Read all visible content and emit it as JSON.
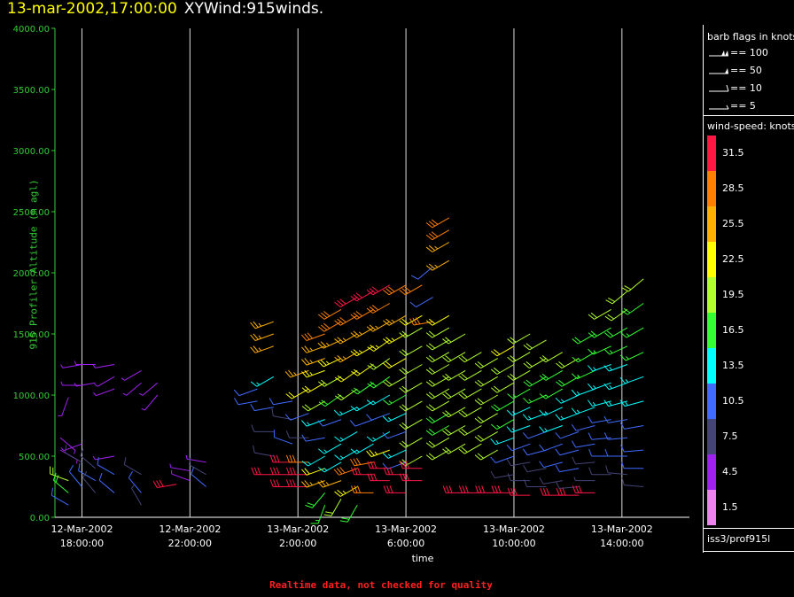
{
  "header": {
    "time": "13-mar-2002,17:00:00",
    "name": "XYWind:915winds."
  },
  "footer": "Realtime data, not checked for quality",
  "source": "iss3/prof915l",
  "legend": {
    "barb_title": "barb flags in knots",
    "barbs": [
      {
        "label": "== 100",
        "kind": "flag2"
      },
      {
        "label": "== 50",
        "kind": "flag"
      },
      {
        "label": "== 10",
        "kind": "full"
      },
      {
        "label": "== 5",
        "kind": "half"
      }
    ],
    "speed_title": "wind-speed: knots",
    "colorscale": [
      {
        "label": "31.5",
        "color": "#ff1744"
      },
      {
        "label": "28.5",
        "color": "#ff7f00"
      },
      {
        "label": "25.5",
        "color": "#ffb000"
      },
      {
        "label": "22.5",
        "color": "#ffff00"
      },
      {
        "label": "19.5",
        "color": "#b2ff2e"
      },
      {
        "label": "16.5",
        "color": "#33ff33"
      },
      {
        "label": "13.5",
        "color": "#00ffff"
      },
      {
        "label": "10.5",
        "color": "#3f6bff"
      },
      {
        "label": "7.5",
        "color": "#444477"
      },
      {
        "label": "4.5",
        "color": "#a020f0"
      },
      {
        "label": "1.5",
        "color": "#ee82ee"
      }
    ]
  },
  "chart_data": {
    "type": "scatter",
    "title": "XYWind:915winds.",
    "xlabel": "time",
    "ylabel": "915 Profiler Altitude (m agl)",
    "ylim": [
      0,
      4000
    ],
    "yticks": [
      "0.00",
      "500.00",
      "1000.00",
      "1500.00",
      "2000.00",
      "2500.00",
      "3000.00",
      "3500.00",
      "4000.00"
    ],
    "xticks": [
      {
        "date": "12-Mar-2002",
        "time": "18:00:00"
      },
      {
        "date": "12-Mar-2002",
        "time": "22:00:00"
      },
      {
        "date": "13-Mar-2002",
        "time": "2:00:00"
      },
      {
        "date": "13-Mar-2002",
        "time": "6:00:00"
      },
      {
        "date": "13-Mar-2002",
        "time": "10:00:00"
      },
      {
        "date": "13-Mar-2002",
        "time": "14:00:00"
      }
    ],
    "xlim_hours": [
      -1.0,
      22.5
    ],
    "grid": "vertical",
    "barb_columns": [
      {
        "h": -0.8,
        "alts": [
          550,
          650
        ],
        "speeds": [
          5,
          6
        ],
        "dirs": [
          120,
          130
        ]
      },
      {
        "h": -0.5,
        "alts": [
          980,
          100,
          200,
          300
        ],
        "speeds": [
          4,
          10,
          18,
          20
        ],
        "dirs": [
          200,
          300,
          310,
          290
        ]
      },
      {
        "h": 0.0,
        "alts": [
          1080,
          1250,
          600,
          450,
          250
        ],
        "speeds": [
          6,
          5,
          4,
          8,
          11
        ],
        "dirs": [
          270,
          260,
          250,
          300,
          320
        ]
      },
      {
        "h": 0.5,
        "alts": [
          1100,
          1250,
          400,
          300,
          200
        ],
        "speeds": [
          5,
          5,
          9,
          10,
          9
        ],
        "dirs": [
          260,
          270,
          310,
          300,
          320
        ]
      },
      {
        "h": 1.2,
        "alts": [
          1050,
          1150,
          1250,
          500,
          350,
          200
        ],
        "speeds": [
          5,
          5,
          4,
          6,
          10,
          10
        ],
        "dirs": [
          250,
          240,
          260,
          260,
          300,
          310
        ]
      },
      {
        "h": 2.2,
        "alts": [
          1100,
          1200,
          350,
          200,
          100
        ],
        "speeds": [
          5,
          5,
          9,
          10,
          7
        ],
        "dirs": [
          230,
          240,
          300,
          320,
          330
        ]
      },
      {
        "h": 2.8,
        "alts": [
          1000,
          1100
        ],
        "speeds": [
          4,
          4
        ],
        "dirs": [
          220,
          230
        ]
      },
      {
        "h": 3.5,
        "alts": [
          270
        ],
        "speeds": [
          31
        ],
        "dirs": [
          260
        ]
      },
      {
        "h": 4.0,
        "alts": [
          380,
          300
        ],
        "speeds": [
          6,
          5
        ],
        "dirs": [
          280,
          290
        ]
      },
      {
        "h": 4.6,
        "alts": [
          450,
          350,
          250
        ],
        "speeds": [
          6,
          9,
          10
        ],
        "dirs": [
          280,
          300,
          310
        ]
      },
      {
        "h": 6.5,
        "alts": [
          1050,
          950
        ],
        "speeds": [
          11,
          12
        ],
        "dirs": [
          250,
          260
        ]
      },
      {
        "h": 7.1,
        "alts": [
          1600,
          1500,
          1400,
          1150,
          900,
          700,
          500,
          350
        ],
        "speeds": [
          27,
          26,
          25,
          14,
          11,
          9,
          8,
          32
        ],
        "dirs": [
          250,
          250,
          250,
          240,
          260,
          270,
          280,
          270
        ]
      },
      {
        "h": 7.8,
        "alts": [
          950,
          800,
          600,
          450,
          350,
          250
        ],
        "speeds": [
          10,
          9,
          10,
          31,
          32,
          32
        ],
        "dirs": [
          260,
          280,
          290,
          270,
          270,
          270
        ]
      },
      {
        "h": 8.4,
        "alts": [
          1200,
          1050,
          850,
          650,
          450,
          350,
          250
        ],
        "speeds": [
          25,
          22,
          12,
          9,
          28,
          31,
          31
        ],
        "dirs": [
          250,
          240,
          250,
          270,
          270,
          270,
          270
        ]
      },
      {
        "h": 9.0,
        "alts": [
          1500,
          1400,
          1300,
          1200,
          1100,
          950,
          800,
          650,
          500,
          400,
          300,
          200,
          100
        ],
        "speeds": [
          29,
          27,
          26,
          24,
          22,
          19,
          13,
          12,
          14,
          22,
          25,
          18,
          16
        ],
        "dirs": [
          250,
          250,
          250,
          250,
          240,
          240,
          250,
          260,
          240,
          250,
          250,
          220,
          200
        ]
      },
      {
        "h": 9.6,
        "alts": [
          1700,
          1600,
          1450,
          1300,
          1150,
          1000,
          800,
          600,
          450,
          300,
          150
        ],
        "speeds": [
          30,
          28,
          26,
          24,
          21,
          18,
          12,
          13,
          15,
          26,
          20
        ],
        "dirs": [
          240,
          240,
          245,
          245,
          240,
          235,
          250,
          240,
          240,
          250,
          210
        ]
      },
      {
        "h": 10.2,
        "alts": [
          1800,
          1650,
          1500,
          1350,
          1200,
          1050,
          900,
          700,
          550,
          400,
          250,
          100
        ],
        "speeds": [
          31,
          29,
          27,
          25,
          22,
          19,
          14,
          14,
          15,
          28,
          24,
          18
        ],
        "dirs": [
          240,
          240,
          240,
          240,
          235,
          235,
          245,
          240,
          240,
          250,
          240,
          210
        ]
      },
      {
        "h": 10.8,
        "alts": [
          1850,
          1700,
          1550,
          1400,
          1250,
          1100,
          950,
          800,
          600,
          450,
          350,
          200
        ],
        "speeds": [
          31,
          28,
          26,
          24,
          22,
          18,
          14,
          12,
          14,
          29,
          31,
          30
        ],
        "dirs": [
          240,
          240,
          240,
          240,
          235,
          235,
          240,
          250,
          240,
          260,
          270,
          270
        ]
      },
      {
        "h": 11.4,
        "alts": [
          1900,
          1750,
          1600,
          1450,
          1300,
          1150,
          1000,
          850,
          700,
          550,
          400,
          300
        ],
        "speeds": [
          31,
          28,
          26,
          24,
          21,
          18,
          14,
          12,
          13,
          24,
          31,
          32
        ],
        "dirs": [
          240,
          240,
          240,
          235,
          235,
          235,
          240,
          250,
          240,
          250,
          270,
          270
        ]
      },
      {
        "h": 12.0,
        "alts": [
          1900,
          1650,
          1500,
          1300,
          1150,
          1000,
          850,
          700,
          550,
          450,
          350,
          200
        ],
        "speeds": [
          30,
          26,
          24,
          22,
          20,
          17,
          14,
          12,
          14,
          12,
          31,
          31
        ],
        "dirs": [
          240,
          240,
          240,
          240,
          240,
          240,
          245,
          250,
          245,
          250,
          270,
          270
        ]
      },
      {
        "h": 12.6,
        "alts": [
          1900,
          1650,
          1550,
          1400,
          1250,
          1100,
          950,
          800,
          650,
          500,
          400,
          300
        ],
        "speeds": [
          29,
          22,
          21,
          21,
          21,
          20,
          20,
          19,
          20,
          21,
          32,
          31
        ],
        "dirs": [
          240,
          240,
          240,
          240,
          240,
          240,
          240,
          240,
          240,
          240,
          270,
          270
        ]
      },
      {
        "h": 13.0,
        "alts": [
          2050,
          1800,
          1600
        ],
        "speeds": [
          10,
          11,
          28
        ],
        "dirs": [
          230,
          240,
          260
        ]
      },
      {
        "h": 13.6,
        "alts": [
          2450,
          2350,
          2250,
          2100,
          1650,
          1550,
          1450,
          1350,
          1250,
          1150,
          1050,
          950,
          850,
          750,
          650,
          550
        ],
        "speeds": [
          29,
          28,
          27,
          27,
          22,
          21,
          21,
          20,
          20,
          20,
          19,
          19,
          18,
          18,
          19,
          20
        ],
        "dirs": [
          240,
          240,
          240,
          240,
          240,
          240,
          240,
          240,
          240,
          240,
          240,
          240,
          240,
          240,
          240,
          240
        ]
      },
      {
        "h": 14.2,
        "alts": [
          1500,
          1350,
          1200,
          1050,
          900,
          750,
          600,
          200
        ],
        "speeds": [
          20,
          21,
          20,
          19,
          19,
          20,
          21,
          32
        ],
        "dirs": [
          240,
          240,
          240,
          240,
          240,
          240,
          240,
          270
        ]
      },
      {
        "h": 14.8,
        "alts": [
          1350,
          1200,
          1050,
          900,
          750,
          600,
          200
        ],
        "speeds": [
          21,
          20,
          19,
          19,
          20,
          20,
          31
        ],
        "dirs": [
          240,
          240,
          240,
          240,
          240,
          240,
          270
        ]
      },
      {
        "h": 15.4,
        "alts": [
          1300,
          1150,
          1000,
          850,
          700,
          550,
          200
        ],
        "speeds": [
          20,
          20,
          19,
          20,
          20,
          21,
          31
        ],
        "dirs": [
          240,
          240,
          240,
          240,
          240,
          240,
          270
        ]
      },
      {
        "h": 16.0,
        "alts": [
          1400,
          1250,
          1100,
          950,
          800,
          650,
          500,
          350,
          200
        ],
        "speeds": [
          22,
          20,
          19,
          18,
          17,
          15,
          12,
          9,
          32
        ],
        "dirs": [
          240,
          240,
          240,
          240,
          240,
          250,
          250,
          260,
          270
        ]
      },
      {
        "h": 16.6,
        "alts": [
          1500,
          1350,
          1200,
          1050,
          900,
          750,
          600,
          450,
          300,
          180
        ],
        "speeds": [
          21,
          20,
          19,
          17,
          15,
          13,
          11,
          9,
          8,
          32
        ],
        "dirs": [
          240,
          240,
          240,
          240,
          245,
          250,
          250,
          260,
          270,
          270
        ]
      },
      {
        "h": 17.2,
        "alts": [
          1450,
          1300,
          1150,
          1000,
          850,
          700,
          550,
          400,
          250
        ],
        "speeds": [
          20,
          19,
          18,
          16,
          14,
          12,
          10,
          9,
          8
        ],
        "dirs": [
          240,
          240,
          240,
          245,
          250,
          250,
          255,
          260,
          270
        ]
      },
      {
        "h": 17.8,
        "alts": [
          1350,
          1200,
          1050,
          900,
          750,
          600,
          450,
          300,
          180
        ],
        "speeds": [
          19,
          18,
          16,
          14,
          13,
          12,
          10,
          8,
          32
        ],
        "dirs": [
          240,
          240,
          240,
          245,
          250,
          250,
          255,
          260,
          270
        ]
      },
      {
        "h": 18.4,
        "alts": [
          1300,
          1150,
          1000,
          850,
          700,
          550,
          400,
          250,
          180
        ],
        "speeds": [
          20,
          18,
          15,
          13,
          12,
          11,
          10,
          9,
          31
        ],
        "dirs": [
          240,
          240,
          245,
          250,
          250,
          255,
          260,
          265,
          270
        ]
      },
      {
        "h": 19.0,
        "alts": [
          1500,
          1350,
          1200,
          1050,
          900,
          750,
          600,
          450,
          300,
          200
        ],
        "speeds": [
          18,
          17,
          16,
          14,
          13,
          12,
          10,
          8,
          7,
          31
        ],
        "dirs": [
          240,
          240,
          245,
          250,
          250,
          255,
          260,
          265,
          270,
          270
        ]
      },
      {
        "h": 19.6,
        "alts": [
          1700,
          1550,
          1400,
          1250,
          1100,
          950,
          800,
          650,
          500,
          350
        ],
        "speeds": [
          19,
          18,
          17,
          15,
          14,
          13,
          12,
          11,
          10,
          9
        ],
        "dirs": [
          240,
          240,
          245,
          250,
          250,
          255,
          260,
          265,
          270,
          270
        ]
      },
      {
        "h": 20.2,
        "alts": [
          1850,
          1700,
          1550,
          1400,
          1250,
          1100,
          950,
          800,
          650,
          500,
          350
        ],
        "speeds": [
          20,
          19,
          18,
          17,
          15,
          14,
          13,
          12,
          11,
          10,
          9
        ],
        "dirs": [
          230,
          235,
          240,
          245,
          250,
          250,
          255,
          260,
          265,
          270,
          275
        ]
      },
      {
        "h": 20.8,
        "alts": [
          1950,
          1750,
          1550,
          1350,
          1150,
          950,
          750,
          550,
          400,
          250
        ],
        "speeds": [
          19,
          18,
          17,
          16,
          14,
          13,
          12,
          11,
          10,
          9
        ],
        "dirs": [
          230,
          235,
          240,
          245,
          250,
          255,
          260,
          265,
          270,
          275
        ]
      }
    ]
  }
}
